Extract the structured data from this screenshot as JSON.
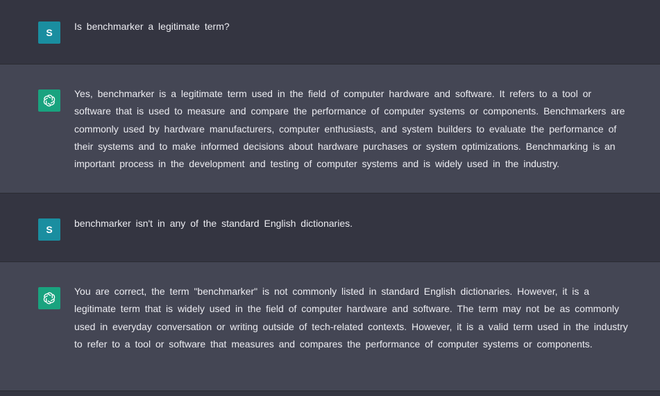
{
  "conversation": {
    "messages": [
      {
        "role": "user",
        "avatar_letter": "S",
        "text": "Is benchmarker a legitimate term?"
      },
      {
        "role": "assistant",
        "avatar_icon": "openai-logo-icon",
        "text": "Yes, benchmarker is a legitimate term used in the field of computer hardware and software. It refers to a tool or software that is used to measure and compare the performance of computer systems or components. Benchmarkers are commonly used by hardware manufacturers, computer enthusiasts, and system builders to evaluate the performance of their systems and to make informed decisions about hardware purchases or system optimizations. Benchmarking is an important process in the development and testing of computer systems and is widely used in the industry."
      },
      {
        "role": "user",
        "avatar_letter": "S",
        "text": "benchmarker isn't in any of the standard English dictionaries."
      },
      {
        "role": "assistant",
        "avatar_icon": "openai-logo-icon",
        "text": "You are correct, the term \"benchmarker\" is not commonly listed in standard English dictionaries. However, it is a legitimate term that is widely used in the field of computer hardware and software. The term may not be as commonly used in everyday conversation or writing outside of tech-related contexts. However, it is a valid term used in the industry to refer to a tool or software that measures and compares the performance of computer systems or components."
      }
    ]
  },
  "colors": {
    "user_background": "#343541",
    "assistant_background": "#444654",
    "user_avatar": "#1a8ea0",
    "assistant_avatar": "#19a37f",
    "text": "#ececf1"
  }
}
